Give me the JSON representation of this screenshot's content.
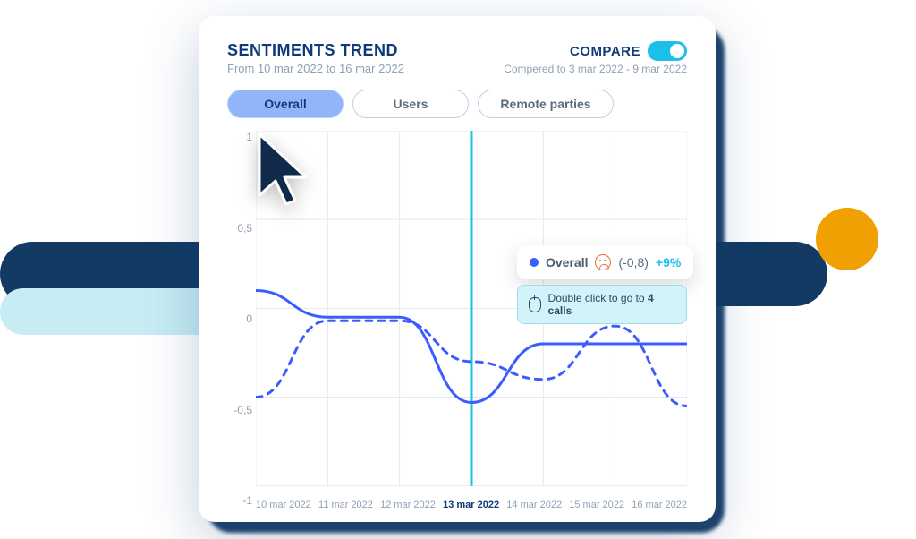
{
  "header": {
    "title": "SENTIMENTS TREND",
    "subtitle": "From 10 mar 2022 to 16 mar 2022"
  },
  "compare": {
    "label": "COMPARE",
    "on": true,
    "subtitle": "Compered to 3 mar 2022 - 9 mar 2022"
  },
  "tabs": {
    "items": [
      {
        "label": "Overall",
        "active": true
      },
      {
        "label": "Users",
        "active": false
      },
      {
        "label": "Remote parties",
        "active": false
      }
    ]
  },
  "tooltip": {
    "series": "Overall",
    "emotion": "sad",
    "value": "(-0,8)",
    "delta": "+9%"
  },
  "hint": {
    "prefix": "Double click to go to ",
    "bold": "4 calls"
  },
  "chart_data": {
    "type": "line",
    "title": "Sentiments Trend",
    "ylabel": "",
    "xlabel": "",
    "ylim": [
      -1,
      1
    ],
    "y_ticks": [
      "1",
      "0,5",
      "0",
      "-0,5",
      "-1"
    ],
    "categories": [
      "10 mar 2022",
      "11 mar 2022",
      "12 mar 2022",
      "13 mar 2022",
      "14 mar 2022",
      "15 mar 2022",
      "16 mar 2022"
    ],
    "highlight_index": 3,
    "series": [
      {
        "name": "Overall",
        "style": "solid",
        "color": "#3b5cff",
        "values": [
          0.1,
          -0.05,
          -0.05,
          -0.53,
          -0.2,
          -0.2,
          -0.2
        ]
      },
      {
        "name": "Compare",
        "style": "dashed",
        "color": "#3b5cff",
        "values": [
          -0.5,
          -0.07,
          -0.07,
          -0.3,
          -0.4,
          -0.1,
          -0.55
        ]
      }
    ],
    "cursor_point": {
      "x_index": 3,
      "y": -0.53
    }
  }
}
